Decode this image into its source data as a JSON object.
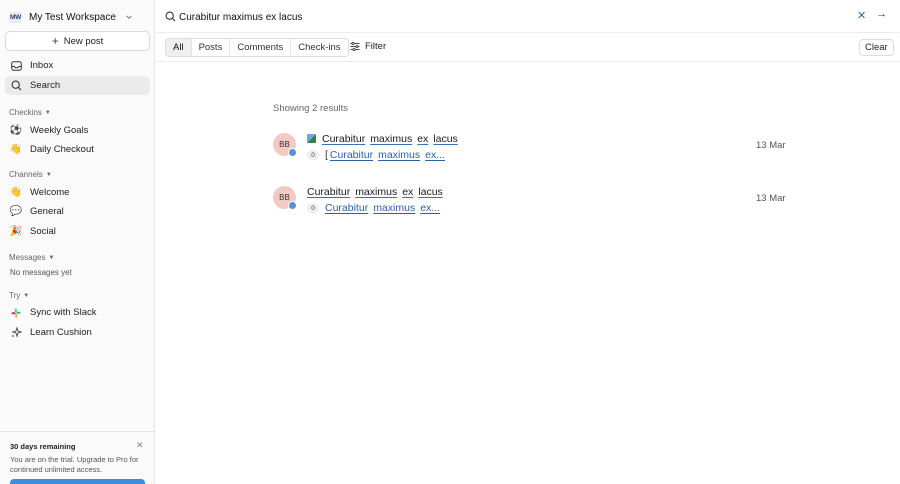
{
  "workspace": {
    "logo_text": "MW",
    "name": "My Test Workspace"
  },
  "new_post_label": "New post",
  "nav": {
    "inbox": "Inbox",
    "search": "Search"
  },
  "checkins": {
    "label": "Checkins",
    "items": [
      {
        "label": "Weekly Goals",
        "icon": "⚽"
      },
      {
        "label": "Daily Checkout",
        "icon": "👋"
      }
    ]
  },
  "channels": {
    "label": "Channels",
    "items": [
      {
        "label": "Welcome",
        "icon": "👋"
      },
      {
        "label": "General",
        "icon": "💬"
      },
      {
        "label": "Social",
        "icon": "🎉"
      }
    ]
  },
  "messages": {
    "label": "Messages",
    "empty": "No messages yet"
  },
  "try": {
    "label": "Try",
    "items": [
      {
        "label": "Sync with Slack",
        "icon": "slack-icon"
      },
      {
        "label": "Learn Cushion",
        "icon": "sparkle-icon"
      }
    ]
  },
  "trial": {
    "title": "30 days remaining",
    "body": "You are on the trial. Upgrade to Pro for continued unlimited access."
  },
  "search": {
    "query": "Curabitur maximus ex lacus"
  },
  "tabs": [
    "All",
    "Posts",
    "Comments",
    "Check-ins"
  ],
  "filter_label": "Filter",
  "clear_label": "Clear",
  "results_summary": "Showing 2 results",
  "results": [
    {
      "avatar": "BB",
      "title_words": [
        "Curabitur",
        "maximus",
        "ex",
        "lacus"
      ],
      "count": "0",
      "snippet_prefix": "[",
      "snippet_words": [
        "Curabitur",
        "maximus",
        "ex..."
      ],
      "date": "13 Mar"
    },
    {
      "avatar": "BB",
      "title_words": [
        "Curabitur",
        "maximus",
        "ex",
        "lacus"
      ],
      "count": "0",
      "snippet_prefix": "",
      "snippet_words": [
        "Curabitur",
        "maximus",
        "ex..."
      ],
      "date": "13 Mar"
    }
  ],
  "colors": {
    "accent": "#3c8de0",
    "link": "#2d5fa3",
    "avatar_bg": "#f3c9c3"
  }
}
